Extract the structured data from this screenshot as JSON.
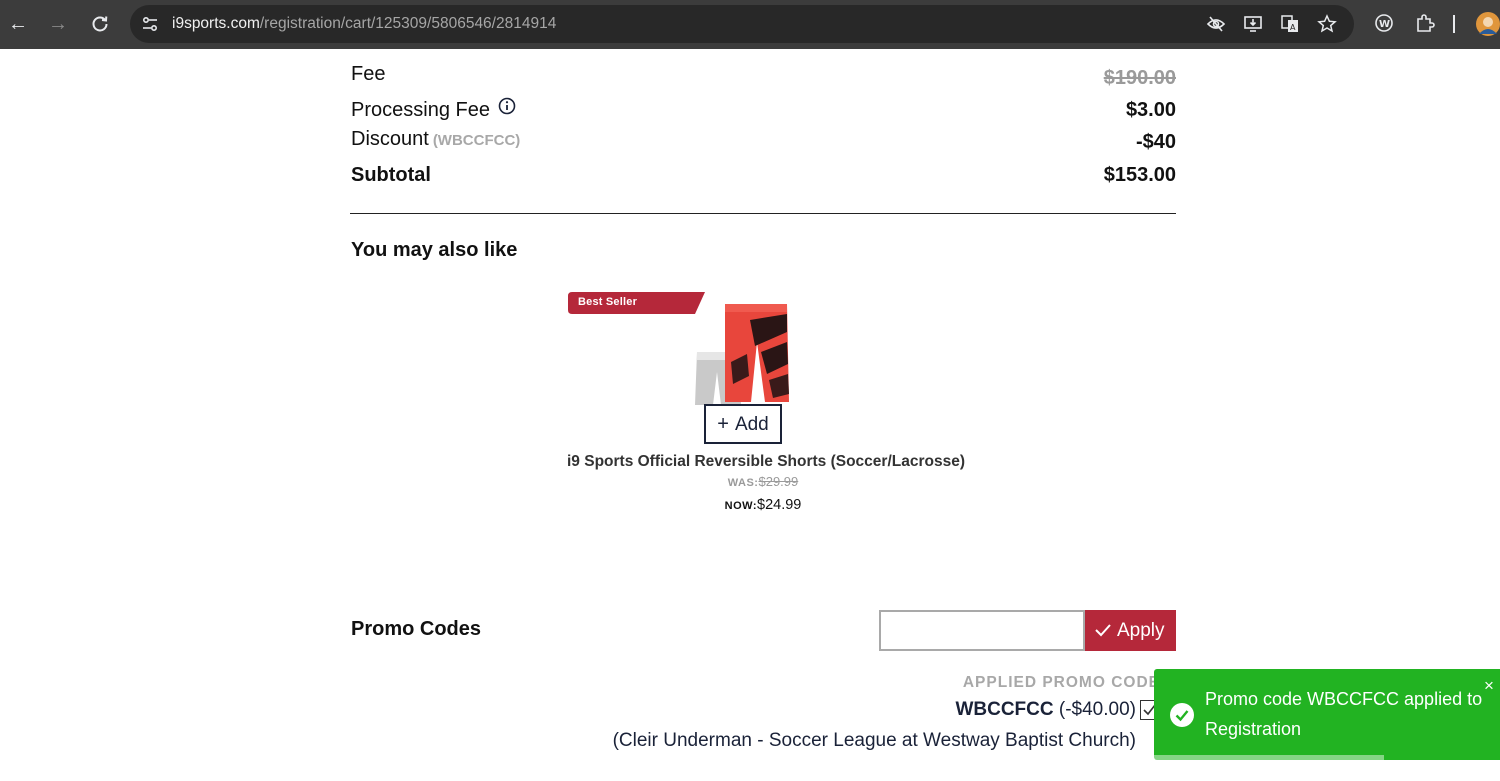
{
  "browser": {
    "url_host": "i9sports.com",
    "url_path": "/registration/cart/125309/5806546/2814914"
  },
  "summary": {
    "fee_label": "Fee",
    "fee_value": "$190.00",
    "processing_label": "Processing Fee",
    "processing_value": "$3.00",
    "discount_label": "Discount",
    "discount_code": "(WBCCFCC)",
    "discount_value": "-$40",
    "subtotal_label": "Subtotal",
    "subtotal_value": "$153.00"
  },
  "upsell": {
    "heading": "You may also like",
    "badge": "Best Seller",
    "add_label": "Add",
    "product_name": "i9 Sports Official Reversible Shorts (Soccer/Lacrosse)",
    "was_label": "WAS:",
    "was_price": "$29.99",
    "now_label": "NOW:",
    "now_price": "$24.99"
  },
  "promo": {
    "heading": "Promo Codes",
    "input_value": "",
    "apply_label": "Apply",
    "applied_heading": "APPLIED PROMO CODE",
    "applied_code": "WBCCFCC",
    "applied_amount": "(-$40.00)",
    "applied_detail": "(Cleir Underman - Soccer League at Westway Baptist Church)"
  },
  "toast": {
    "message": "Promo code WBCCFCC applied to Registration",
    "close": "×"
  },
  "colors": {
    "brand_red": "#b5283a",
    "toast_green": "#22b322",
    "navy": "#1a2238"
  }
}
